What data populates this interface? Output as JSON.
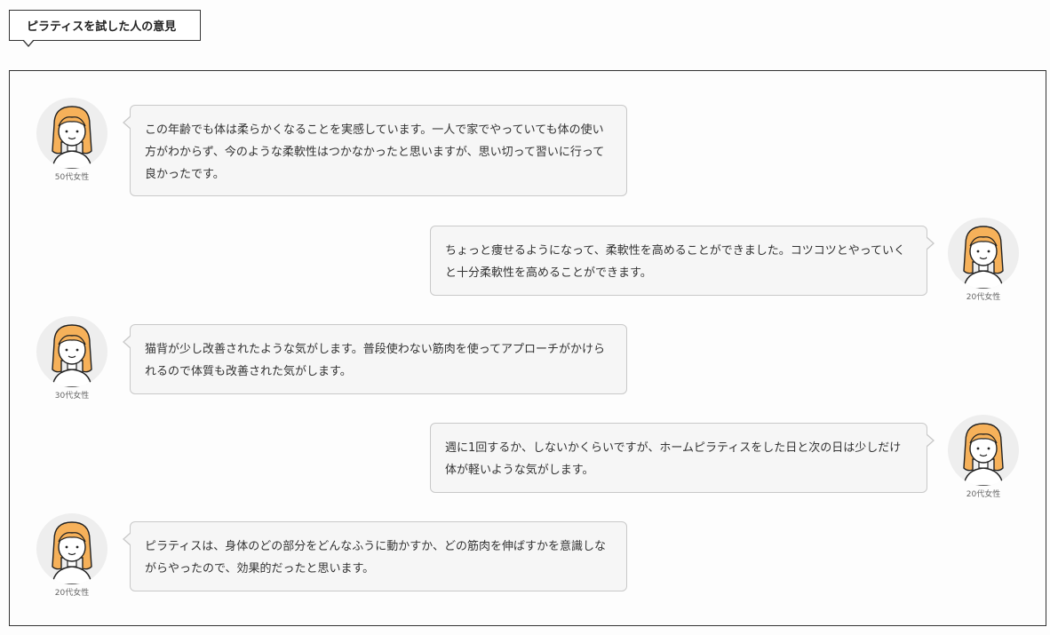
{
  "section": {
    "title": "ピラティスを試した人の意見"
  },
  "reviews": [
    {
      "position": "left",
      "caption": "50代女性",
      "text": "この年齢でも体は柔らかくなることを実感しています。一人で家でやっていても体の使い方がわからず、今のような柔軟性はつかなかったと思いますが、思い切って習いに行って良かったです。",
      "avatar_icon": "woman-avatar-icon"
    },
    {
      "position": "right",
      "caption": "20代女性",
      "text": "ちょっと痩せるようになって、柔軟性を高めることができました。コツコツとやっていくと十分柔軟性を高めることができます。",
      "avatar_icon": "woman-avatar-icon"
    },
    {
      "position": "left",
      "caption": "30代女性",
      "text": "猫背が少し改善されたような気がします。普段使わない筋肉を使ってアプローチがかけられるので体質も改善された気がします。",
      "avatar_icon": "woman-avatar-icon"
    },
    {
      "position": "right",
      "caption": "20代女性",
      "text": "週に1回するか、しないかくらいですが、ホームピラティスをした日と次の日は少しだけ体が軽いような気がします。",
      "avatar_icon": "woman-avatar-icon"
    },
    {
      "position": "left",
      "caption": "20代女性",
      "text": "ピラティスは、身体のどの部分をどんなふうに動かすか、どの筋肉を伸ばすかを意識しながらやったので、効果的だったと思います。",
      "avatar_icon": "woman-avatar-icon"
    }
  ],
  "colors": {
    "hair": "#f6b15a",
    "skin": "#ffffff",
    "avatar_bg": "#eeeeee",
    "bubble_bg": "#f6f6f6",
    "bubble_border": "#c9c9c9",
    "frame_border": "#333333"
  }
}
